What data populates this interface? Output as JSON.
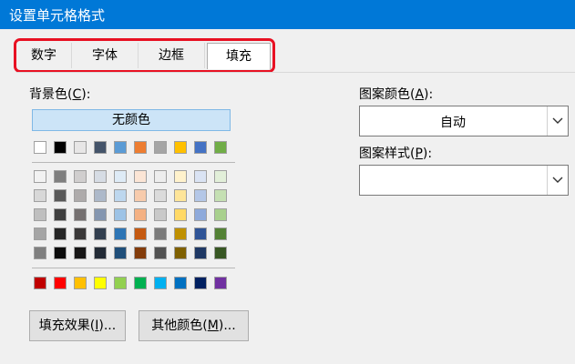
{
  "window": {
    "title": "设置单元格格式"
  },
  "tabs": [
    {
      "label": "数字"
    },
    {
      "label": "字体"
    },
    {
      "label": "边框"
    },
    {
      "label": "填充",
      "active": true
    }
  ],
  "background": {
    "label": "背景色",
    "mnemonic": "C",
    "no_color_label": "无颜色",
    "theme_top_row": [
      "#ffffff",
      "#000000",
      "#e7e6e6",
      "#44546a",
      "#5b9bd5",
      "#ed7d31",
      "#a5a5a5",
      "#ffc000",
      "#4472c4",
      "#70ad47"
    ],
    "theme_shades": [
      [
        "#f2f2f2",
        "#7f7f7f",
        "#d0cece",
        "#d6dce4",
        "#deebf6",
        "#fbe5d5",
        "#ededed",
        "#fff2cc",
        "#dae3f3",
        "#e2efd9"
      ],
      [
        "#d8d8d8",
        "#595959",
        "#aeabab",
        "#adb9ca",
        "#bdd7ee",
        "#f7cbac",
        "#dbdbdb",
        "#fee599",
        "#b4c7e7",
        "#c5e0b3"
      ],
      [
        "#bfbfbf",
        "#3f3f3f",
        "#757070",
        "#8496b0",
        "#9dc3e6",
        "#f4b183",
        "#c9c9c9",
        "#ffd966",
        "#8eaadb",
        "#a8d08d"
      ],
      [
        "#a5a5a5",
        "#262626",
        "#3a3838",
        "#323f4f",
        "#2e75b5",
        "#c55a11",
        "#7b7b7b",
        "#bf9000",
        "#2f5496",
        "#538135"
      ],
      [
        "#7f7f7f",
        "#0c0c0c",
        "#171616",
        "#222a35",
        "#1f4e79",
        "#833c0b",
        "#525252",
        "#7f6000",
        "#1f3864",
        "#375623"
      ]
    ],
    "standard_colors": [
      "#c00000",
      "#ff0000",
      "#ffc000",
      "#ffff00",
      "#92d050",
      "#00b050",
      "#00b0f0",
      "#0070c0",
      "#002060",
      "#7030a0"
    ]
  },
  "pattern_color": {
    "label": "图案颜色",
    "mnemonic": "A",
    "value": "自动"
  },
  "pattern_style": {
    "label": "图案样式",
    "mnemonic": "P",
    "value": ""
  },
  "buttons": {
    "fill_effects": {
      "label": "填充效果",
      "mnemonic": "I",
      "suffix": "..."
    },
    "more_colors": {
      "label": "其他颜色",
      "mnemonic": "M",
      "suffix": "..."
    }
  }
}
